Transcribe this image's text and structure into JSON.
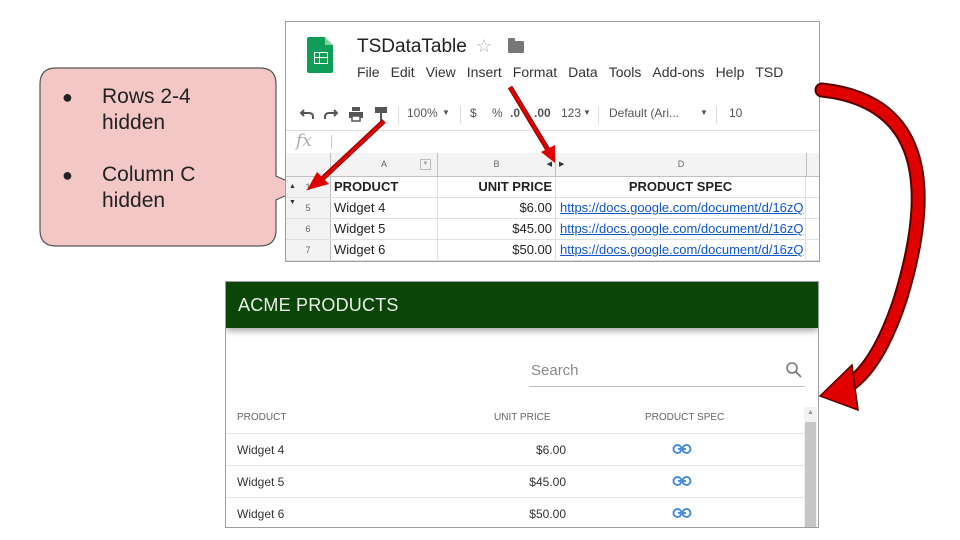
{
  "callout": {
    "items": [
      "Rows 2-4 hidden",
      "Column C hidden"
    ]
  },
  "sheets": {
    "title": "TSDataTable",
    "menu": [
      "File",
      "Edit",
      "View",
      "Insert",
      "Format",
      "Data",
      "Tools",
      "Add-ons",
      "Help",
      "TSD"
    ],
    "toolbar": {
      "zoom": "100%",
      "currency": "$",
      "percent": "%",
      "dec_decrease": ".0",
      "dec_increase": ".00",
      "number_format": "123",
      "font": "Default (Ari...",
      "font_size": "10"
    },
    "fx": "fx",
    "columns": [
      "A",
      "B",
      "D"
    ],
    "header_row": {
      "num": "1",
      "product": "PRODUCT",
      "unit_price": "UNIT PRICE",
      "product_spec": "PRODUCT SPEC"
    },
    "rows": [
      {
        "num": "5",
        "product": "Widget 4",
        "price": "$6.00",
        "spec": "https://docs.google.com/document/d/16zQ"
      },
      {
        "num": "6",
        "product": "Widget 5",
        "price": "$45.00",
        "spec": "https://docs.google.com/document/d/16zQ"
      },
      {
        "num": "7",
        "product": "Widget 6",
        "price": "$50.00",
        "spec": "https://docs.google.com/document/d/16zQ"
      }
    ]
  },
  "acme": {
    "title": "ACME PRODUCTS",
    "search_placeholder": "Search",
    "headers": {
      "product": "PRODUCT",
      "unit_price": "UNIT PRICE",
      "product_spec": "PRODUCT SPEC"
    },
    "rows": [
      {
        "product": "Widget 4",
        "price": "$6.00"
      },
      {
        "product": "Widget 5",
        "price": "$45.00"
      },
      {
        "product": "Widget 6",
        "price": "$50.00"
      }
    ]
  },
  "colors": {
    "acme_header": "#0b4508",
    "callout_fill": "#f4c7c7",
    "arrow_red": "#e00000",
    "link_blue": "#1155cc",
    "link_icon": "#4a8fd8"
  }
}
